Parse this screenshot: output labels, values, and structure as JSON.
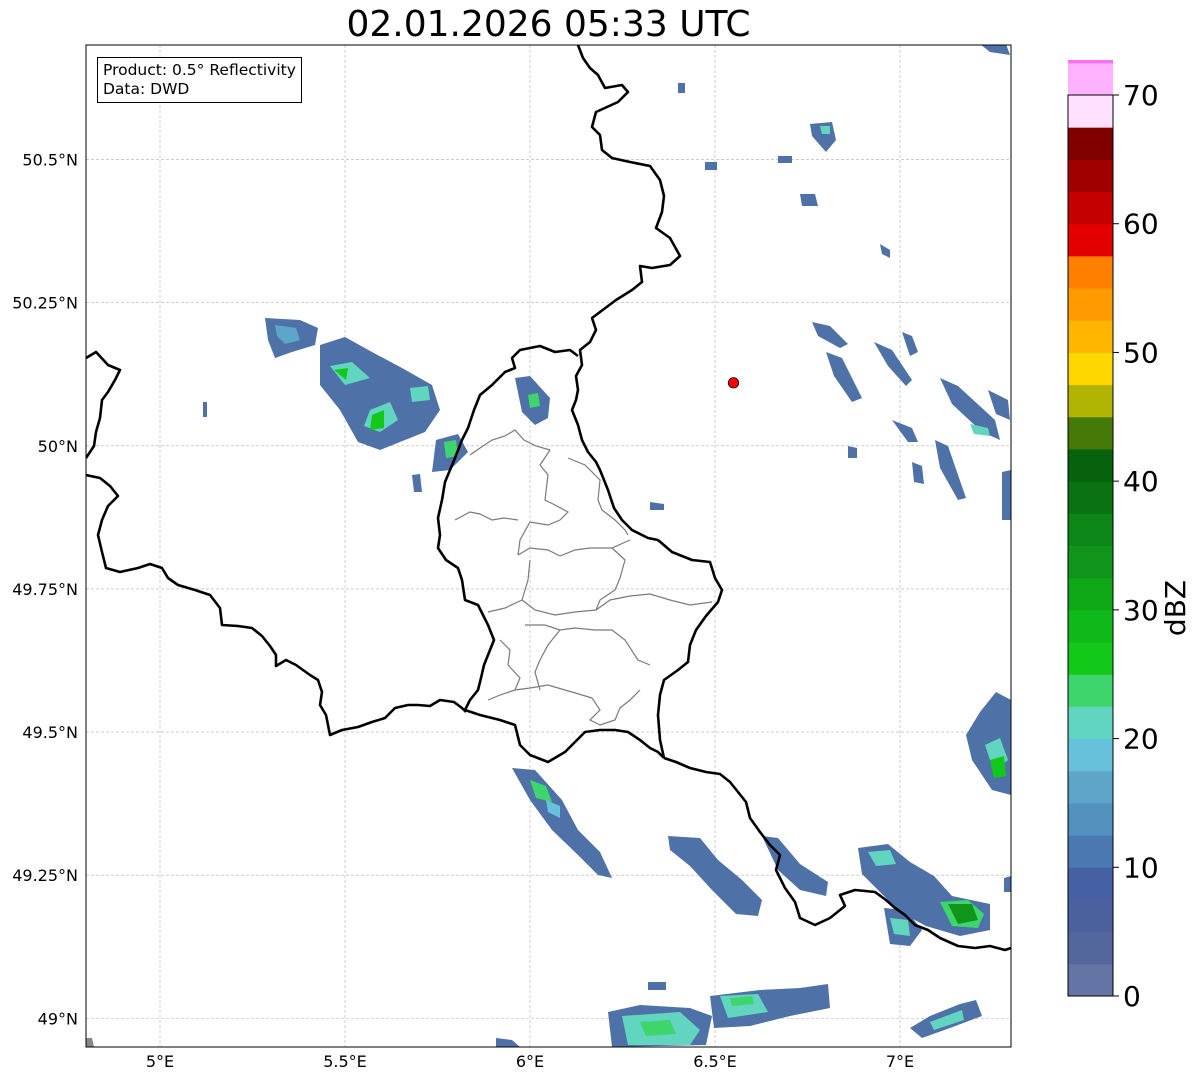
{
  "title": "02.01.2026 05:33 UTC",
  "info": {
    "product": "Product: 0.5° Reflectivity",
    "data": "Data: DWD"
  },
  "map": {
    "lon_range": [
      4.8,
      7.3
    ],
    "lat_range": [
      48.95,
      50.7
    ],
    "lon_ticks": [
      {
        "value": 5.0,
        "label": "5°E"
      },
      {
        "value": 5.5,
        "label": "5.5°E"
      },
      {
        "value": 6.0,
        "label": "6°E"
      },
      {
        "value": 6.5,
        "label": "6.5°E"
      },
      {
        "value": 7.0,
        "label": "7°E"
      }
    ],
    "lat_ticks": [
      {
        "value": 49.0,
        "label": "49°N"
      },
      {
        "value": 49.25,
        "label": "49.25°N"
      },
      {
        "value": 49.5,
        "label": "49.5°N"
      },
      {
        "value": 49.75,
        "label": "49.75°N"
      },
      {
        "value": 50.0,
        "label": "50°N"
      },
      {
        "value": 50.25,
        "label": "50.25°N"
      },
      {
        "value": 50.5,
        "label": "50.5°N"
      }
    ],
    "gridlines": true,
    "radar_site": {
      "lon": 6.55,
      "lat": 50.11,
      "color": "#ff0000"
    }
  },
  "colorbar": {
    "label": "dBZ",
    "min": 0,
    "max": 70,
    "step": 2.5,
    "tick_values": [
      0,
      10,
      20,
      30,
      40,
      50,
      60,
      70
    ],
    "colors": [
      "#6475a5",
      "#53679d",
      "#4a609f",
      "#4561a3",
      "#4b78b0",
      "#5391be",
      "#5da6c9",
      "#67c1db",
      "#61d5c0",
      "#3dd56c",
      "#12c91a",
      "#10b91a",
      "#11a818",
      "#10951a",
      "#0c8717",
      "#0b7214",
      "#06620d",
      "#467a08",
      "#b2b404",
      "#ffd700",
      "#ffb600",
      "#ff9b00",
      "#ff7f00",
      "#e30000",
      "#c40000",
      "#a00000",
      "#800000",
      "#ffe1ff",
      "#ffb2ff",
      "#ff6ef9"
    ]
  }
}
